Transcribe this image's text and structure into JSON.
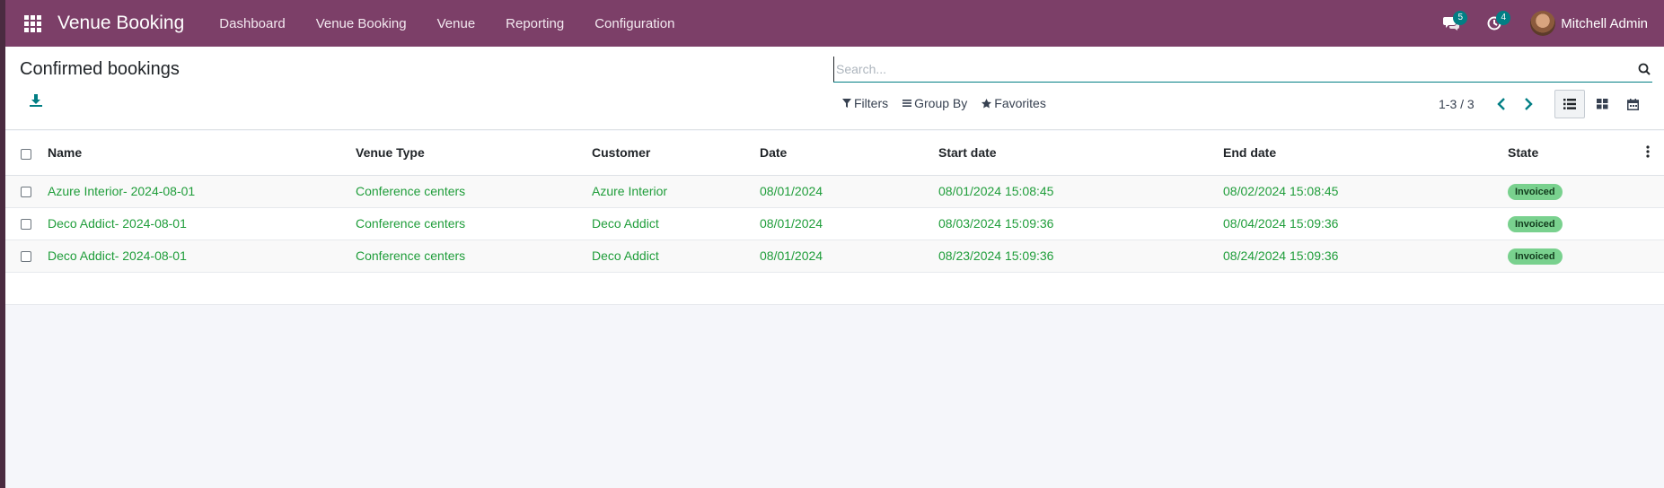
{
  "navbar": {
    "brand": "Venue Booking",
    "menu": [
      "Dashboard",
      "Venue Booking",
      "Venue",
      "Reporting",
      "Configuration"
    ],
    "messages_count": "5",
    "activities_count": "4",
    "user_name": "Mitchell Admin",
    "color": "#7c3f68"
  },
  "control_panel": {
    "title": "Confirmed bookings",
    "search_placeholder": "Search...",
    "filters_label": "Filters",
    "group_by_label": "Group By",
    "favorites_label": "Favorites",
    "pager": "1-3 / 3"
  },
  "table": {
    "columns": [
      "Name",
      "Venue Type",
      "Customer",
      "Date",
      "Start date",
      "End date",
      "State"
    ],
    "rows": [
      [
        "Azure Interior- 2024-08-01",
        "Conference centers",
        "Azure Interior",
        "08/01/2024",
        "08/01/2024 15:08:45",
        "08/02/2024 15:08:45",
        "Invoiced"
      ],
      [
        "Deco Addict- 2024-08-01",
        "Conference centers",
        "Deco Addict",
        "08/01/2024",
        "08/03/2024 15:09:36",
        "08/04/2024 15:09:36",
        "Invoiced"
      ],
      [
        "Deco Addict- 2024-08-01",
        "Conference centers",
        "Deco Addict",
        "08/01/2024",
        "08/23/2024 15:09:36",
        "08/24/2024 15:09:36",
        "Invoiced"
      ]
    ],
    "row_text_color": "#1f9d3a",
    "state_badge_color": "#79d18e"
  }
}
